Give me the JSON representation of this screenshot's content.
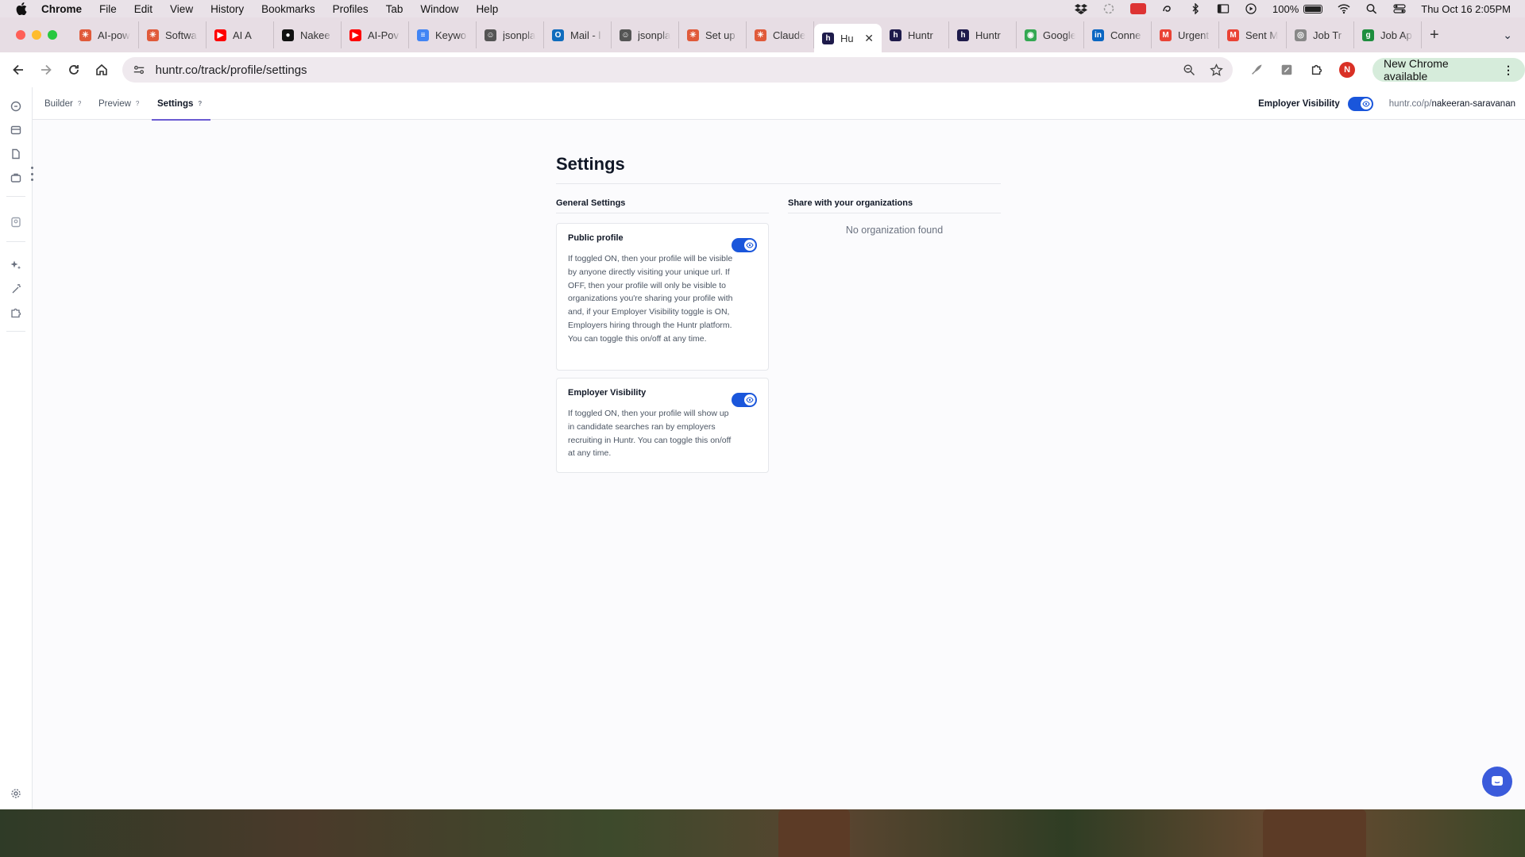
{
  "menubar": {
    "app_name": "Chrome",
    "items": [
      "File",
      "Edit",
      "View",
      "History",
      "Bookmarks",
      "Profiles",
      "Tab",
      "Window",
      "Help"
    ],
    "battery": "100%",
    "datetime": "Thu Oct 16  2:05PM"
  },
  "tabs": [
    {
      "label": "AI-pow",
      "fav_color": "#e05a3a",
      "fav_glyph": "✳"
    },
    {
      "label": "Softwa",
      "fav_color": "#e05a3a",
      "fav_glyph": "✳"
    },
    {
      "label": "AI A",
      "fav_color": "#ff0000",
      "fav_glyph": "▶"
    },
    {
      "label": "Nakee",
      "fav_color": "#111111",
      "fav_glyph": "●"
    },
    {
      "label": "AI-Pov",
      "fav_color": "#ff0000",
      "fav_glyph": "▶"
    },
    {
      "label": "Keywo",
      "fav_color": "#4285f4",
      "fav_glyph": "≡"
    },
    {
      "label": "jsonpla",
      "fav_color": "#555555",
      "fav_glyph": "☺"
    },
    {
      "label": "Mail - l",
      "fav_color": "#0f6cbd",
      "fav_glyph": "O"
    },
    {
      "label": "jsonpla",
      "fav_color": "#555555",
      "fav_glyph": "☺"
    },
    {
      "label": "Set up",
      "fav_color": "#e05a3a",
      "fav_glyph": "✳"
    },
    {
      "label": "Claude",
      "fav_color": "#e05a3a",
      "fav_glyph": "✳"
    },
    {
      "label": "Hu",
      "fav_color": "#1e1b4b",
      "fav_glyph": "h",
      "active": true
    },
    {
      "label": "Huntr",
      "fav_color": "#1e1b4b",
      "fav_glyph": "h"
    },
    {
      "label": "Huntr",
      "fav_color": "#1e1b4b",
      "fav_glyph": "h"
    },
    {
      "label": "Google",
      "fav_color": "#34a853",
      "fav_glyph": "◉"
    },
    {
      "label": "Conne",
      "fav_color": "#0a66c2",
      "fav_glyph": "in"
    },
    {
      "label": "Urgent",
      "fav_color": "#ea4335",
      "fav_glyph": "M"
    },
    {
      "label": "Sent M",
      "fav_color": "#ea4335",
      "fav_glyph": "M"
    },
    {
      "label": "Job Tr",
      "fav_color": "#888888",
      "fav_glyph": "◎"
    },
    {
      "label": "Job Ap",
      "fav_color": "#1e8e3e",
      "fav_glyph": "g"
    }
  ],
  "toolbar": {
    "url": "huntr.co/track/profile/settings",
    "update_label": "New Chrome available",
    "profile_initial": "N"
  },
  "nav": {
    "tabs": [
      {
        "label": "Builder",
        "help": "?"
      },
      {
        "label": "Preview",
        "help": "?"
      },
      {
        "label": "Settings",
        "help": "?"
      }
    ],
    "employer_visibility_label": "Employer Visibility",
    "profile_link_prefix": "huntr.co/p/",
    "profile_link_slug": "nakeeran-saravanan"
  },
  "settings": {
    "title": "Settings",
    "general_heading": "General Settings",
    "share_heading": "Share with your organizations",
    "no_org": "No organization found",
    "public_profile": {
      "title": "Public profile",
      "enabled": true,
      "description": "If toggled ON, then your profile will be visible by anyone directly visiting your unique url. If OFF, then your profile will only be visible to organizations you're sharing your profile with and, if your Employer Visibility toggle is ON, Employers hiring through the Huntr platform. You can toggle this on/off at any time."
    },
    "employer_visibility": {
      "title": "Employer Visibility",
      "enabled": true,
      "description": "If toggled ON, then your profile will show up in candidate searches ran by employers recruiting in Huntr. You can toggle this on/off at any time."
    }
  },
  "colors": {
    "accent": "#1a56db",
    "nav_underline": "#6b5bd2",
    "chat": "#3b5bdb"
  }
}
